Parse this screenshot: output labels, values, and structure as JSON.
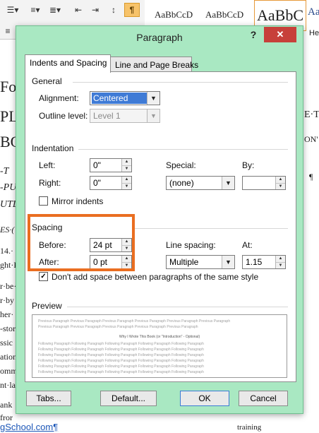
{
  "ribbon": {
    "paragraph_mark": "¶",
    "styles": [
      "AaBbCcD",
      "AaBbCcD",
      "AaBbC",
      "AaB",
      "He"
    ]
  },
  "document": {
    "fragments": [
      "Fo",
      "PL",
      "BO",
      "-T",
      "-PU",
      "UTLI",
      "ES·(",
      "14.·",
      "ght·F",
      "r·be·",
      "r·by",
      "her·",
      "-stor",
      "ssic",
      "ation",
      "omm",
      "nt·la",
      "ank",
      "fror",
      "E·T",
      "ON'",
      "¶",
      "training"
    ],
    "link": "gSchool.com¶"
  },
  "dialog": {
    "title": "Paragraph",
    "help": "?",
    "close": "✕",
    "tabs": {
      "indents_spacing": "Indents and Spacing",
      "line_page_breaks": "Line and Page Breaks"
    },
    "general": {
      "heading": "General",
      "alignment_label": "Alignment:",
      "alignment_value": "Centered",
      "outline_label": "Outline level:",
      "outline_value": "Level 1"
    },
    "indentation": {
      "heading": "Indentation",
      "left_label": "Left:",
      "left_value": "0\"",
      "right_label": "Right:",
      "right_value": "0\"",
      "special_label": "Special:",
      "special_value": "(none)",
      "by_label": "By:",
      "by_value": "",
      "mirror_label": "Mirror indents"
    },
    "spacing": {
      "heading": "Spacing",
      "before_label": "Before:",
      "before_value": "24 pt",
      "after_label": "After:",
      "after_value": "0 pt",
      "line_spacing_label": "Line spacing:",
      "line_spacing_value": "Multiple",
      "at_label": "At:",
      "at_value": "1.15",
      "dont_add_label": "Don't add space between paragraphs of the same style",
      "dont_add_checked": true
    },
    "preview": {
      "heading": "Preview",
      "prev_line_1": "Previous Paragraph Previous Paragraph Previous Paragraph Previous Paragraph Previous Paragraph Previous Paragraph",
      "prev_line_2": "Previous Paragraph Previous Paragraph Previous Paragraph Previous Paragraph Previous Paragraph",
      "main_line": "Why I Wrote This Book (or \"Introduction\" - Optional)",
      "follow_line": "Following Paragraph Following Paragraph Following Paragraph Following Paragraph Following Paragraph"
    },
    "buttons": {
      "tabs": "Tabs...",
      "default": "Default...",
      "ok": "OK",
      "cancel": "Cancel"
    }
  },
  "colors": {
    "dialog_frame": "#a9e8c2",
    "close_button": "#c7403a",
    "highlight": "#ea6e21",
    "selection": "#3f7bd6"
  }
}
